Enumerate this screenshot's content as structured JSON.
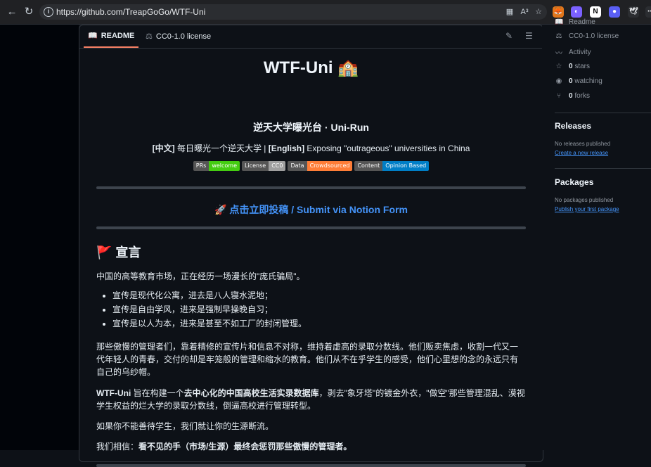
{
  "browser": {
    "url": "https://github.com/TreapGoGo/WTF-Uni",
    "reader_icon": "A",
    "read_aloud": "A³"
  },
  "readme_header": {
    "tab_readme": "README",
    "tab_license": "CC0-1.0 license"
  },
  "readme": {
    "title": "WTF-Uni 🏫",
    "subtitle": "逆天大学曝光台 · Uni-Run",
    "desc_cn_tag": "[中文]",
    "desc_cn": " 每日曝光一个逆天大学 | ",
    "desc_en_tag": "[English]",
    "desc_en": " Exposing \"outrageous\" universities in China",
    "badges": [
      {
        "label": "PRs",
        "value": "welcome",
        "color": "#4c1"
      },
      {
        "label": "License",
        "value": "CC0",
        "color": "#9f9f9f"
      },
      {
        "label": "Data",
        "value": "Crowdsourced",
        "color": "#fe7d37"
      },
      {
        "label": "Content",
        "value": "Opinion Based",
        "color": "#007ec6"
      }
    ],
    "submit_link": "🚀 点击立即投稿 / Submit via Notion Form",
    "manifesto_heading": "🚩 宣言",
    "p1": "中国的高等教育市场，正在经历一场漫长的\"庞氏骗局\"。",
    "bullets": [
      "宣传是现代化公寓，进去是八人寝水泥地；",
      "宣传是自由学风，进来是强制早操晚自习；",
      "宣传是以人为本，进来是甚至不如工厂的封闭管理。"
    ],
    "p2": "那些傲慢的管理者们，靠着精修的宣传片和信息不对称，维持着虚高的录取分数线。他们贩卖焦虑，收割一代又一代年轻人的青春，交付的却是牢笼般的管理和缩水的教育。他们从不在乎学生的感受，他们心里想的念的永远只有自己的乌纱帽。",
    "p3_a": "WTF-Uni",
    "p3_b": " 旨在构建一个",
    "p3_c": "去中心化的中国高校生活实录数据库",
    "p3_d": "，剥去\"象牙塔\"的镀金外衣，\"做空\"那些管理混乱、漠视学生权益的烂大学的录取分数线，倒逼高校进行管理转型。",
    "p4": "如果你不能善待学生，我们就让你的生源断流。",
    "p5_a": "我们相信：",
    "p5_b": "看不见的手（市场/生源）最终会惩罚那些傲慢的管理者。"
  },
  "sidebar": {
    "readme_label": "Readme",
    "license_label": "CC0-1.0 license",
    "activity_label": "Activity",
    "stars_count": "0",
    "stars_label": " stars",
    "watching_count": "0",
    "watching_label": " watching",
    "forks_count": "0",
    "forks_label": " forks",
    "releases_heading": "Releases",
    "releases_empty": "No releases published",
    "releases_link": "Create a new release",
    "packages_heading": "Packages",
    "packages_empty": "No packages published",
    "packages_link": "Publish your first package"
  }
}
